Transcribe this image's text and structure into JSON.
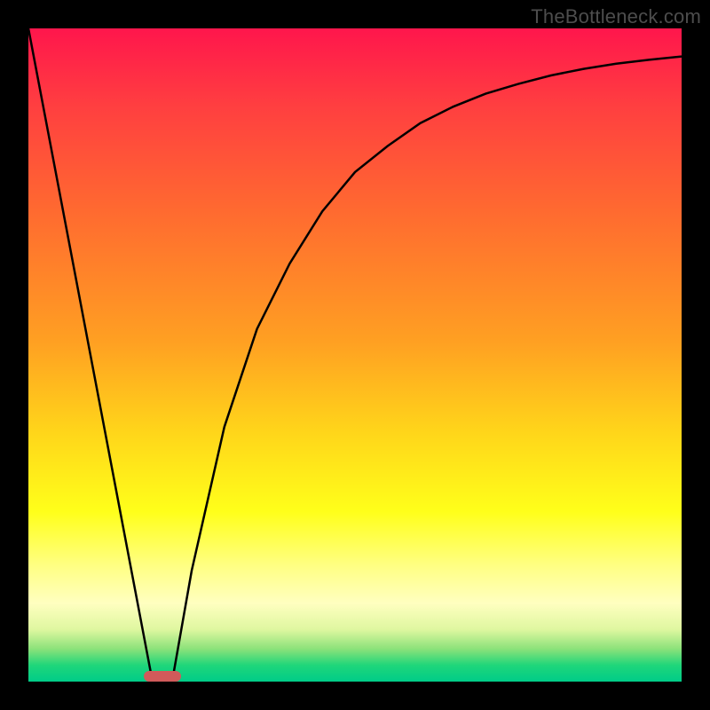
{
  "watermark": "TheBottleneck.com",
  "colors": {
    "border": "#000000",
    "curve": "#000000",
    "marker": "#d15a5a",
    "gradient_stops": [
      "#ff164c",
      "#ff3f40",
      "#ff6a30",
      "#ffa022",
      "#ffd61a",
      "#ffff1a",
      "#ffff80",
      "#ffffc0",
      "#dff7a0",
      "#8be27a",
      "#1fd67a",
      "#00cc88"
    ]
  },
  "chart_data": {
    "type": "line",
    "x": [
      0.0,
      0.05,
      0.1,
      0.15,
      0.19,
      0.22,
      0.25,
      0.3,
      0.35,
      0.4,
      0.45,
      0.5,
      0.55,
      0.6,
      0.65,
      0.7,
      0.75,
      0.8,
      0.85,
      0.9,
      0.95,
      1.0
    ],
    "series": [
      {
        "name": "left-line",
        "x": [
          0.0,
          0.19
        ],
        "y": [
          1.0,
          0.0
        ]
      },
      {
        "name": "right-curve",
        "x": [
          0.22,
          0.25,
          0.3,
          0.35,
          0.4,
          0.45,
          0.5,
          0.55,
          0.6,
          0.65,
          0.7,
          0.75,
          0.8,
          0.85,
          0.9,
          0.95,
          1.0
        ],
        "y": [
          0.0,
          0.17,
          0.39,
          0.54,
          0.64,
          0.72,
          0.78,
          0.82,
          0.855,
          0.88,
          0.9,
          0.915,
          0.928,
          0.938,
          0.946,
          0.952,
          0.957
        ]
      }
    ],
    "marker": {
      "x_center": 0.205,
      "width_frac": 0.057,
      "y": 0.0
    },
    "xlim": [
      0,
      1
    ],
    "ylim": [
      0,
      1
    ],
    "title": "",
    "xlabel": "",
    "ylabel": "",
    "grid": false,
    "legend": false
  }
}
